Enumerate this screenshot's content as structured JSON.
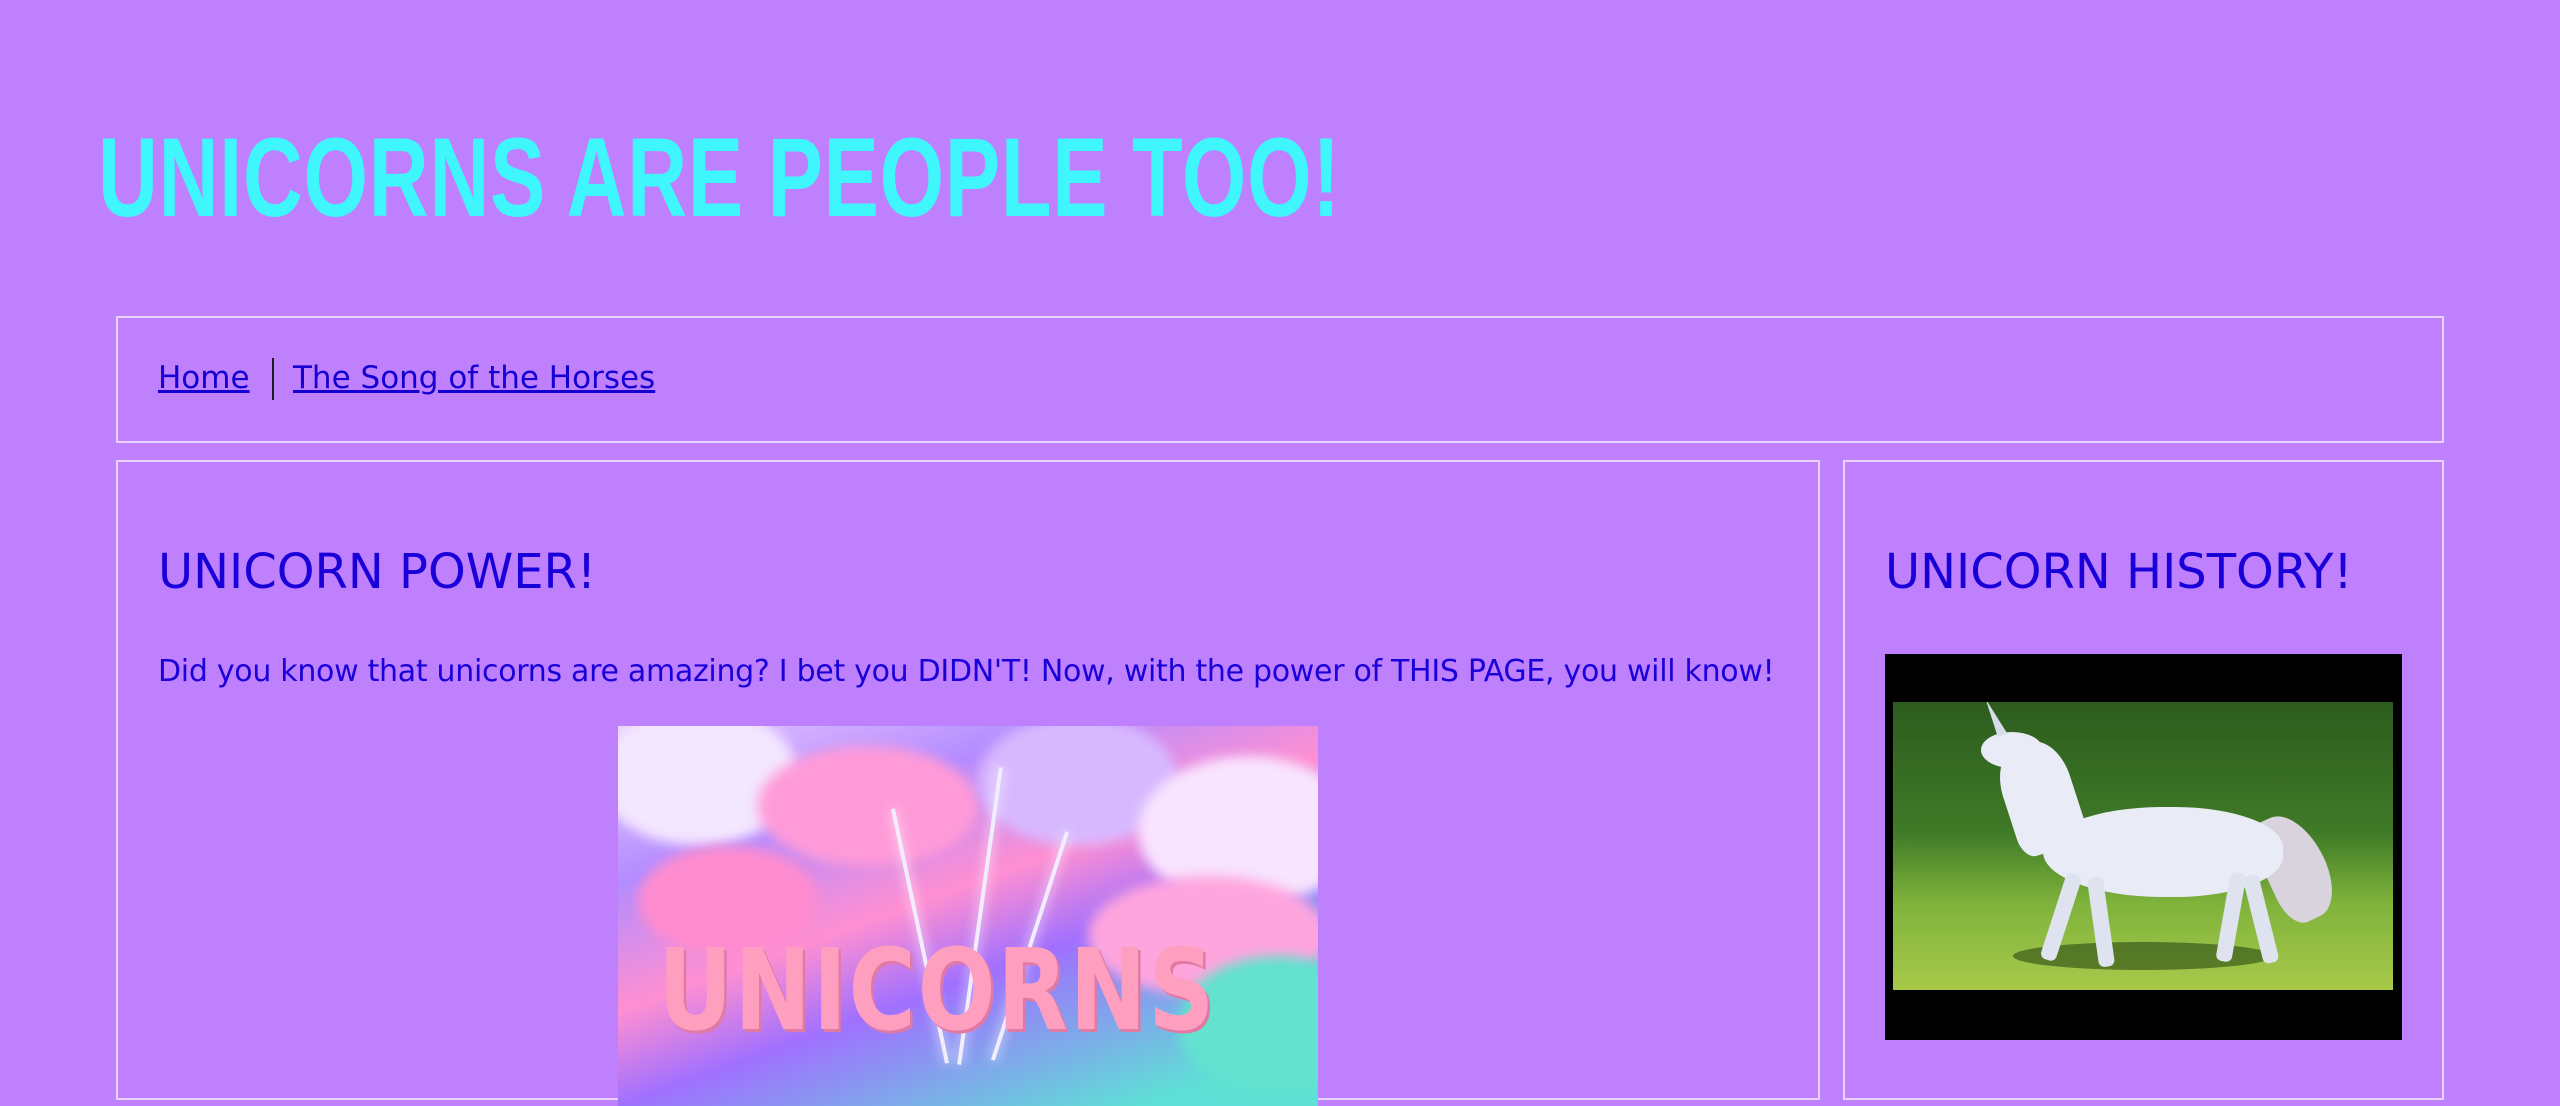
{
  "header": {
    "site_title": "UNICORNS ARE PEOPLE TOO!"
  },
  "nav": {
    "items": [
      {
        "label": "Home"
      },
      {
        "label": "The Song of the Horses"
      }
    ]
  },
  "main": {
    "heading": "UNICORN POWER!",
    "intro_before": "Did you know that unicorns are amazing? I bet you DIDN'T! Now, with the power of ",
    "intro_emphasis": "THIS PAGE",
    "intro_after": ", you will know!",
    "image_text": "UNICORNS"
  },
  "sidebar": {
    "heading": "UNICORN HISTORY!"
  },
  "colors": {
    "background": "#bf80fe",
    "title": "#3ff6fd",
    "text": "#1a00d8",
    "border": "#e7d2ff"
  }
}
